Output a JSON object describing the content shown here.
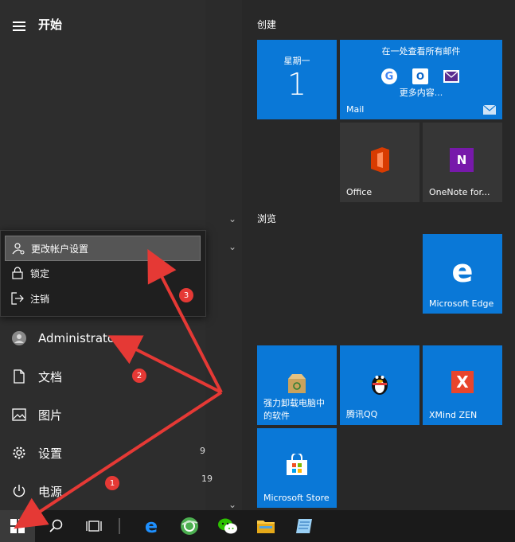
{
  "start": {
    "title": "开始"
  },
  "rail": {
    "user_name": "Administrator",
    "documents": "文档",
    "pictures": "图片",
    "settings": "设置",
    "power": "电源"
  },
  "popup": {
    "change_account": "更改帐户设置",
    "lock": "锁定",
    "signout": "注销"
  },
  "list_fragments": {
    "a": "9",
    "b": "19"
  },
  "groups": {
    "create": "创建",
    "browse": "浏览"
  },
  "tiles": {
    "calendar_weekday": "星期一",
    "calendar_day": "1",
    "mail_header": "在一处查看所有邮件",
    "mail_more": "更多内容...",
    "mail_label": "Mail",
    "office": "Office",
    "onenote": "OneNote for...",
    "edge": "Microsoft Edge",
    "uninstall_line1": "强力卸载电脑中",
    "uninstall_line2": "的软件",
    "qq": "腾讯QQ",
    "xmind": "XMind ZEN",
    "store": "Microsoft Store"
  },
  "badges": {
    "one": "1",
    "two": "2",
    "three": "3"
  },
  "colors": {
    "tile_blue": "#0a78d7",
    "arrow_red": "#e53935",
    "taskbar": "#1a1a1a"
  }
}
